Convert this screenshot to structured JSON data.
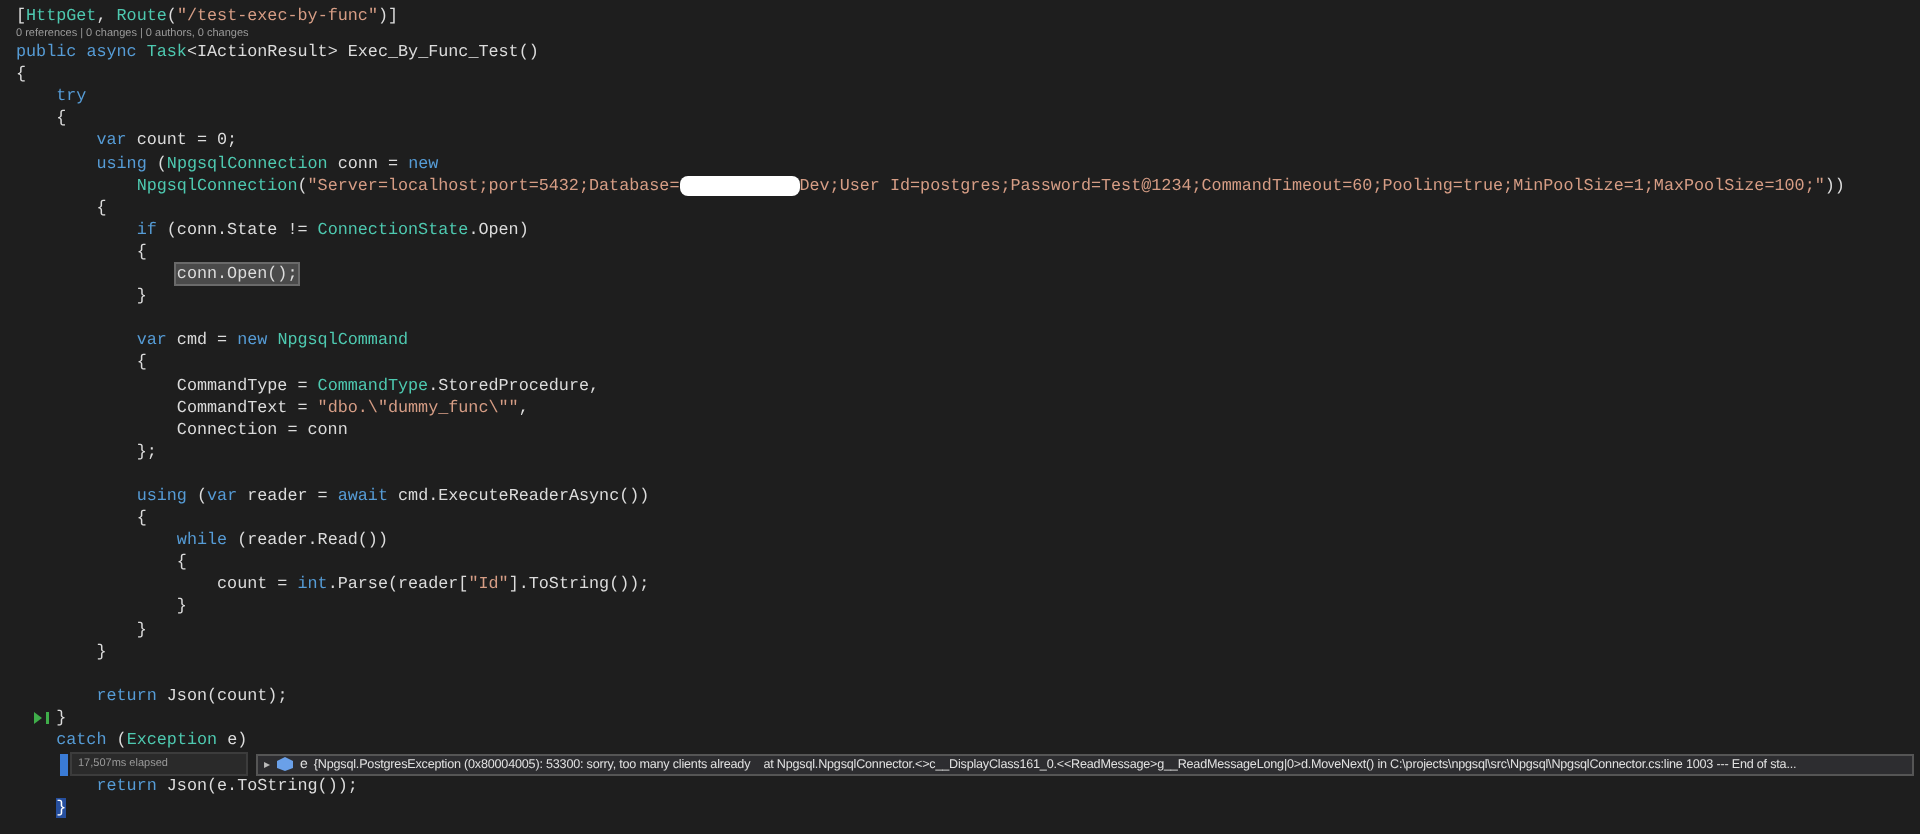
{
  "editor": {
    "lines": [
      {
        "kind": "code",
        "tokens": [
          {
            "t": "[",
            "kind": "plain"
          },
          {
            "t": "HttpGet",
            "kind": "type"
          },
          {
            "t": ", ",
            "kind": "plain"
          },
          {
            "t": "Route",
            "kind": "type"
          },
          {
            "t": "(",
            "kind": "plain"
          },
          {
            "t": "\"/test-exec-by-func\"",
            "kind": "str"
          },
          {
            "t": ")]",
            "kind": "plain"
          }
        ]
      },
      {
        "kind": "lens",
        "text": "0 references | 0 changes | 0 authors, 0 changes"
      },
      {
        "kind": "code",
        "tokens": [
          {
            "t": "public",
            "kind": "kw"
          },
          {
            "t": " async",
            "kind": "kw"
          },
          {
            "t": " Task",
            "kind": "type"
          },
          {
            "t": "<IActionResult> Exec_By_Func_Test()",
            "kind": "plain"
          }
        ]
      },
      {
        "kind": "code",
        "tokens": [
          {
            "t": "{",
            "kind": "plain"
          }
        ]
      },
      {
        "kind": "code",
        "tokens": [
          {
            "t": "    try",
            "kind": "kw"
          }
        ]
      },
      {
        "kind": "code",
        "tokens": [
          {
            "t": "    {",
            "kind": "plain"
          }
        ]
      },
      {
        "kind": "code",
        "tokens": [
          {
            "t": "        var",
            "kind": "kw"
          },
          {
            "t": " count = 0;",
            "kind": "plain"
          }
        ]
      },
      {
        "kind": "code",
        "tokens": [
          {
            "t": "        using",
            "kind": "kw"
          },
          {
            "t": " (",
            "kind": "plain"
          },
          {
            "t": "NpgsqlConnection",
            "kind": "type"
          },
          {
            "t": " conn = ",
            "kind": "plain"
          },
          {
            "t": "new",
            "kind": "kw"
          }
        ]
      },
      {
        "kind": "code",
        "tokens": [
          {
            "t": "            NpgsqlConnection",
            "kind": "type"
          },
          {
            "t": "(",
            "kind": "plain"
          },
          {
            "t": "\"Server=localhost;port=5432;Database=",
            "kind": "str"
          },
          {
            "kind": "redact"
          },
          {
            "t": "Dev;User Id=postgres;Password=Test@1234;CommandTimeout=60;Pooling=true;MinPoolSize=1;MaxPoolSize=100;\"",
            "kind": "str"
          },
          {
            "t": "))",
            "kind": "plain"
          }
        ]
      },
      {
        "kind": "code",
        "tokens": [
          {
            "t": "        {",
            "kind": "plain"
          }
        ]
      },
      {
        "kind": "code",
        "tokens": [
          {
            "t": "            if",
            "kind": "kw"
          },
          {
            "t": " (conn.State != ",
            "kind": "plain"
          },
          {
            "t": "ConnectionState",
            "kind": "type"
          },
          {
            "t": ".Open)",
            "kind": "plain"
          }
        ]
      },
      {
        "kind": "code",
        "tokens": [
          {
            "t": "            {",
            "kind": "plain"
          }
        ]
      },
      {
        "kind": "code",
        "tokens": [
          {
            "t": "                conn.Open();",
            "kind": "hl"
          }
        ]
      },
      {
        "kind": "code",
        "tokens": [
          {
            "t": "            }",
            "kind": "plain"
          }
        ]
      },
      {
        "kind": "blank"
      },
      {
        "kind": "code",
        "tokens": [
          {
            "t": "            var",
            "kind": "kw"
          },
          {
            "t": " cmd = ",
            "kind": "plain"
          },
          {
            "t": "new",
            "kind": "kw"
          },
          {
            "t": " NpgsqlCommand",
            "kind": "type"
          }
        ]
      },
      {
        "kind": "code",
        "tokens": [
          {
            "t": "            {",
            "kind": "plain"
          }
        ]
      },
      {
        "kind": "code",
        "tokens": [
          {
            "t": "                CommandType = ",
            "kind": "plain"
          },
          {
            "t": "CommandType",
            "kind": "type"
          },
          {
            "t": ".StoredProcedure,",
            "kind": "plain"
          }
        ]
      },
      {
        "kind": "code",
        "tokens": [
          {
            "t": "                CommandText = ",
            "kind": "plain"
          },
          {
            "t": "\"dbo.\\\"dummy_func\\\"\"",
            "kind": "str"
          },
          {
            "t": ",",
            "kind": "plain"
          }
        ]
      },
      {
        "kind": "code",
        "tokens": [
          {
            "t": "                Connection = conn",
            "kind": "plain"
          }
        ]
      },
      {
        "kind": "code",
        "tokens": [
          {
            "t": "            };",
            "kind": "plain"
          }
        ]
      },
      {
        "kind": "blank"
      },
      {
        "kind": "code",
        "tokens": [
          {
            "t": "            using",
            "kind": "kw"
          },
          {
            "t": " (",
            "kind": "plain"
          },
          {
            "t": "var",
            "kind": "kw"
          },
          {
            "t": " reader = ",
            "kind": "plain"
          },
          {
            "t": "await",
            "kind": "kw"
          },
          {
            "t": " cmd.ExecuteReaderAsync())",
            "kind": "plain"
          }
        ]
      },
      {
        "kind": "code",
        "tokens": [
          {
            "t": "            {",
            "kind": "plain"
          }
        ]
      },
      {
        "kind": "code",
        "tokens": [
          {
            "t": "                while",
            "kind": "kw"
          },
          {
            "t": " (reader.Read())",
            "kind": "plain"
          }
        ]
      },
      {
        "kind": "code",
        "tokens": [
          {
            "t": "                {",
            "kind": "plain"
          }
        ]
      },
      {
        "kind": "code",
        "tokens": [
          {
            "t": "                    count = ",
            "kind": "plain"
          },
          {
            "t": "int",
            "kind": "kw"
          },
          {
            "t": ".Parse(reader[",
            "kind": "plain"
          },
          {
            "t": "\"Id\"",
            "kind": "str"
          },
          {
            "t": "].ToString());",
            "kind": "plain"
          }
        ]
      },
      {
        "kind": "code",
        "tokens": [
          {
            "t": "                }",
            "kind": "plain"
          }
        ]
      },
      {
        "kind": "code",
        "tokens": [
          {
            "t": "            }",
            "kind": "plain"
          }
        ]
      },
      {
        "kind": "code",
        "tokens": [
          {
            "t": "        }",
            "kind": "plain"
          }
        ]
      },
      {
        "kind": "blank"
      },
      {
        "kind": "code",
        "tokens": [
          {
            "t": "        return",
            "kind": "kw"
          },
          {
            "t": " Json(count);",
            "kind": "plain"
          }
        ]
      },
      {
        "kind": "code",
        "current": true,
        "tokens": [
          {
            "t": "    }",
            "kind": "plain"
          }
        ]
      },
      {
        "kind": "code",
        "tokens": [
          {
            "t": "    catch",
            "kind": "kw"
          },
          {
            "t": " (",
            "kind": "plain"
          },
          {
            "t": "Exception",
            "kind": "type"
          },
          {
            "t": " e)",
            "kind": "plain"
          }
        ]
      },
      {
        "kind": "datatip",
        "elapsed": "17,507ms elapsed",
        "expander": "▸",
        "name": "e",
        "value": "{Npgsql.PostgresException (0x80004005): 53300: sorry, too many clients already    at Npgsql.NpgsqlConnector.<>c__DisplayClass161_0.<<ReadMessage>g__ReadMessageLong|0>d.MoveNext() in C:\\projects\\npgsql\\src\\Npgsql\\NpgsqlConnector.cs:line 1003 --- End of sta..."
      },
      {
        "kind": "code",
        "tokens": [
          {
            "t": "        return",
            "kind": "kw"
          },
          {
            "t": " Json(e.ToString());",
            "kind": "plain"
          }
        ]
      },
      {
        "kind": "code",
        "tokens": [
          {
            "t": "    }",
            "kind": "brace"
          }
        ]
      }
    ]
  }
}
